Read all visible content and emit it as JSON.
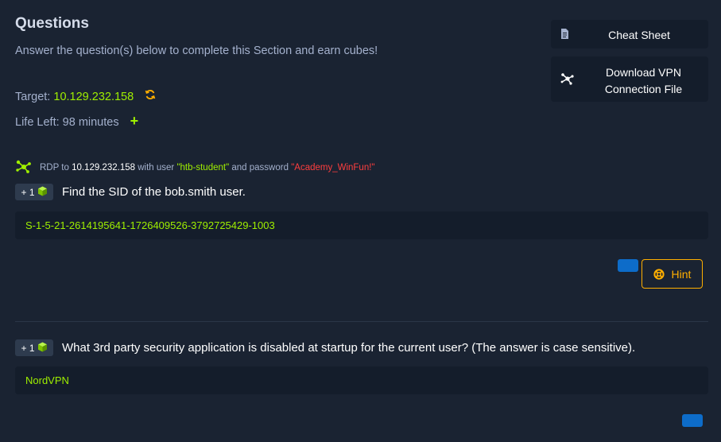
{
  "section": {
    "title": "Questions",
    "subtitle": "Answer the question(s) below to complete this Section and earn cubes!",
    "target_label": "Target:",
    "target_ip": "10.129.232.158",
    "life_label": "Life Left:",
    "life_value": "98 minutes"
  },
  "side": {
    "cheat_sheet": "Cheat Sheet",
    "vpn_line1": "Download VPN",
    "vpn_line2": "Connection File"
  },
  "rdp": {
    "prefix": "RDP to",
    "ip": "10.129.232.158",
    "mid": "with user",
    "user": "\"htb-student\"",
    "mid2": "and password",
    "password": "\"Academy_WinFun!\""
  },
  "questions": [
    {
      "reward": "+ 1",
      "text": "Find the SID of the bob.smith user.",
      "answer": "S-1-5-21-2614195641-1726409526-3792725429-1003",
      "hint_label": "Hint"
    },
    {
      "reward": "+ 1",
      "text": "What 3rd party security application is disabled at startup for the current user? (The answer is case sensitive).",
      "answer": "NordVPN"
    }
  ],
  "icons": {
    "refresh": "refresh-icon",
    "add": "plus-icon",
    "cheat_sheet": "document-icon",
    "vpn": "network-icon",
    "rdp": "network-icon",
    "cube": "cube-icon",
    "hint": "lifebuoy-icon"
  },
  "colors": {
    "background": "#1a2332",
    "panel": "#141d2b",
    "accent_green": "#9fef00",
    "accent_orange": "#ffaf00",
    "accent_red": "#ff3e3e",
    "button_blue": "#0d6cc9"
  }
}
